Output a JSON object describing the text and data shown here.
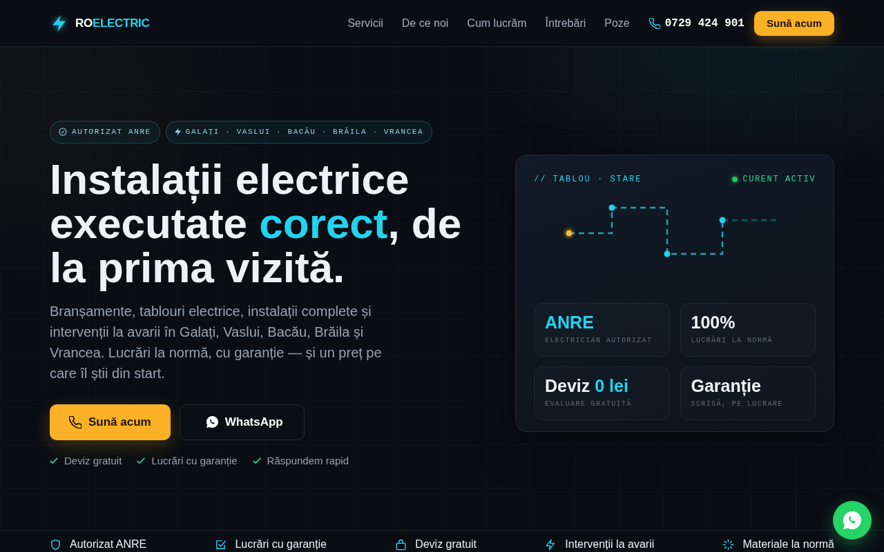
{
  "header": {
    "logo": {
      "prefix": "RO",
      "accent": "ELECTRIC"
    },
    "nav": [
      "Servicii",
      "De ce noi",
      "Cum lucrăm",
      "Întrebări",
      "Poze"
    ],
    "phone": "0729 424 901",
    "cta": "Sună acum"
  },
  "hero": {
    "badges": [
      {
        "kind": "check",
        "text": "AUTORIZAT ANRE"
      },
      {
        "kind": "bolt",
        "text": "GALAȚI · VASLUI · BACĂU · BRĂILA · VRANCEA"
      }
    ],
    "title": [
      {
        "text": "Instalații electrice executate ",
        "highlight": false
      },
      {
        "text": "corect",
        "highlight": true
      },
      {
        "text": ", de la prima vizită.",
        "highlight": false
      }
    ],
    "description": "Branșamente, tablouri electrice, instalații complete și intervenții la avarii în Galați, Vaslui, Bacău, Brăila și Vrancea. Lucrări la normă, cu garanție — și un preț pe care îl știi din start.",
    "buttons": [
      {
        "kind": "call",
        "label": "Sună acum"
      },
      {
        "kind": "whatsapp",
        "label": "WhatsApp"
      }
    ],
    "perks": [
      "Deviz gratuit",
      "Lucrări cu garanție",
      "Răspundem rapid"
    ]
  },
  "panel": {
    "title": "// TABLOU · STARE",
    "status": "CURENT ACTIV",
    "stats": [
      {
        "value": [
          {
            "text": "ANRE",
            "highlight": true
          }
        ],
        "label": "ELECTRICIAN AUTORIZAT"
      },
      {
        "value": [
          {
            "text": "100%",
            "highlight": false
          }
        ],
        "label": "LUCRĂRI LA NORMĂ"
      },
      {
        "value": [
          {
            "text": "Deviz ",
            "highlight": false
          },
          {
            "text": "0 lei",
            "highlight": true
          }
        ],
        "label": "EVALUARE GRATUITĂ"
      },
      {
        "value": [
          {
            "text": "Garanție",
            "highlight": false
          }
        ],
        "label": "SCRISĂ, PE LUCRARE"
      }
    ]
  },
  "features": [
    {
      "kind": "shield",
      "text": "Autorizat ANRE"
    },
    {
      "kind": "checklist",
      "text": "Lucrări cu garanție"
    },
    {
      "kind": "bag",
      "text": "Deviz gratuit"
    },
    {
      "kind": "bolt",
      "text": "Intervenții la avarii"
    },
    {
      "kind": "sparkle",
      "text": "Materiale la normă"
    }
  ]
}
